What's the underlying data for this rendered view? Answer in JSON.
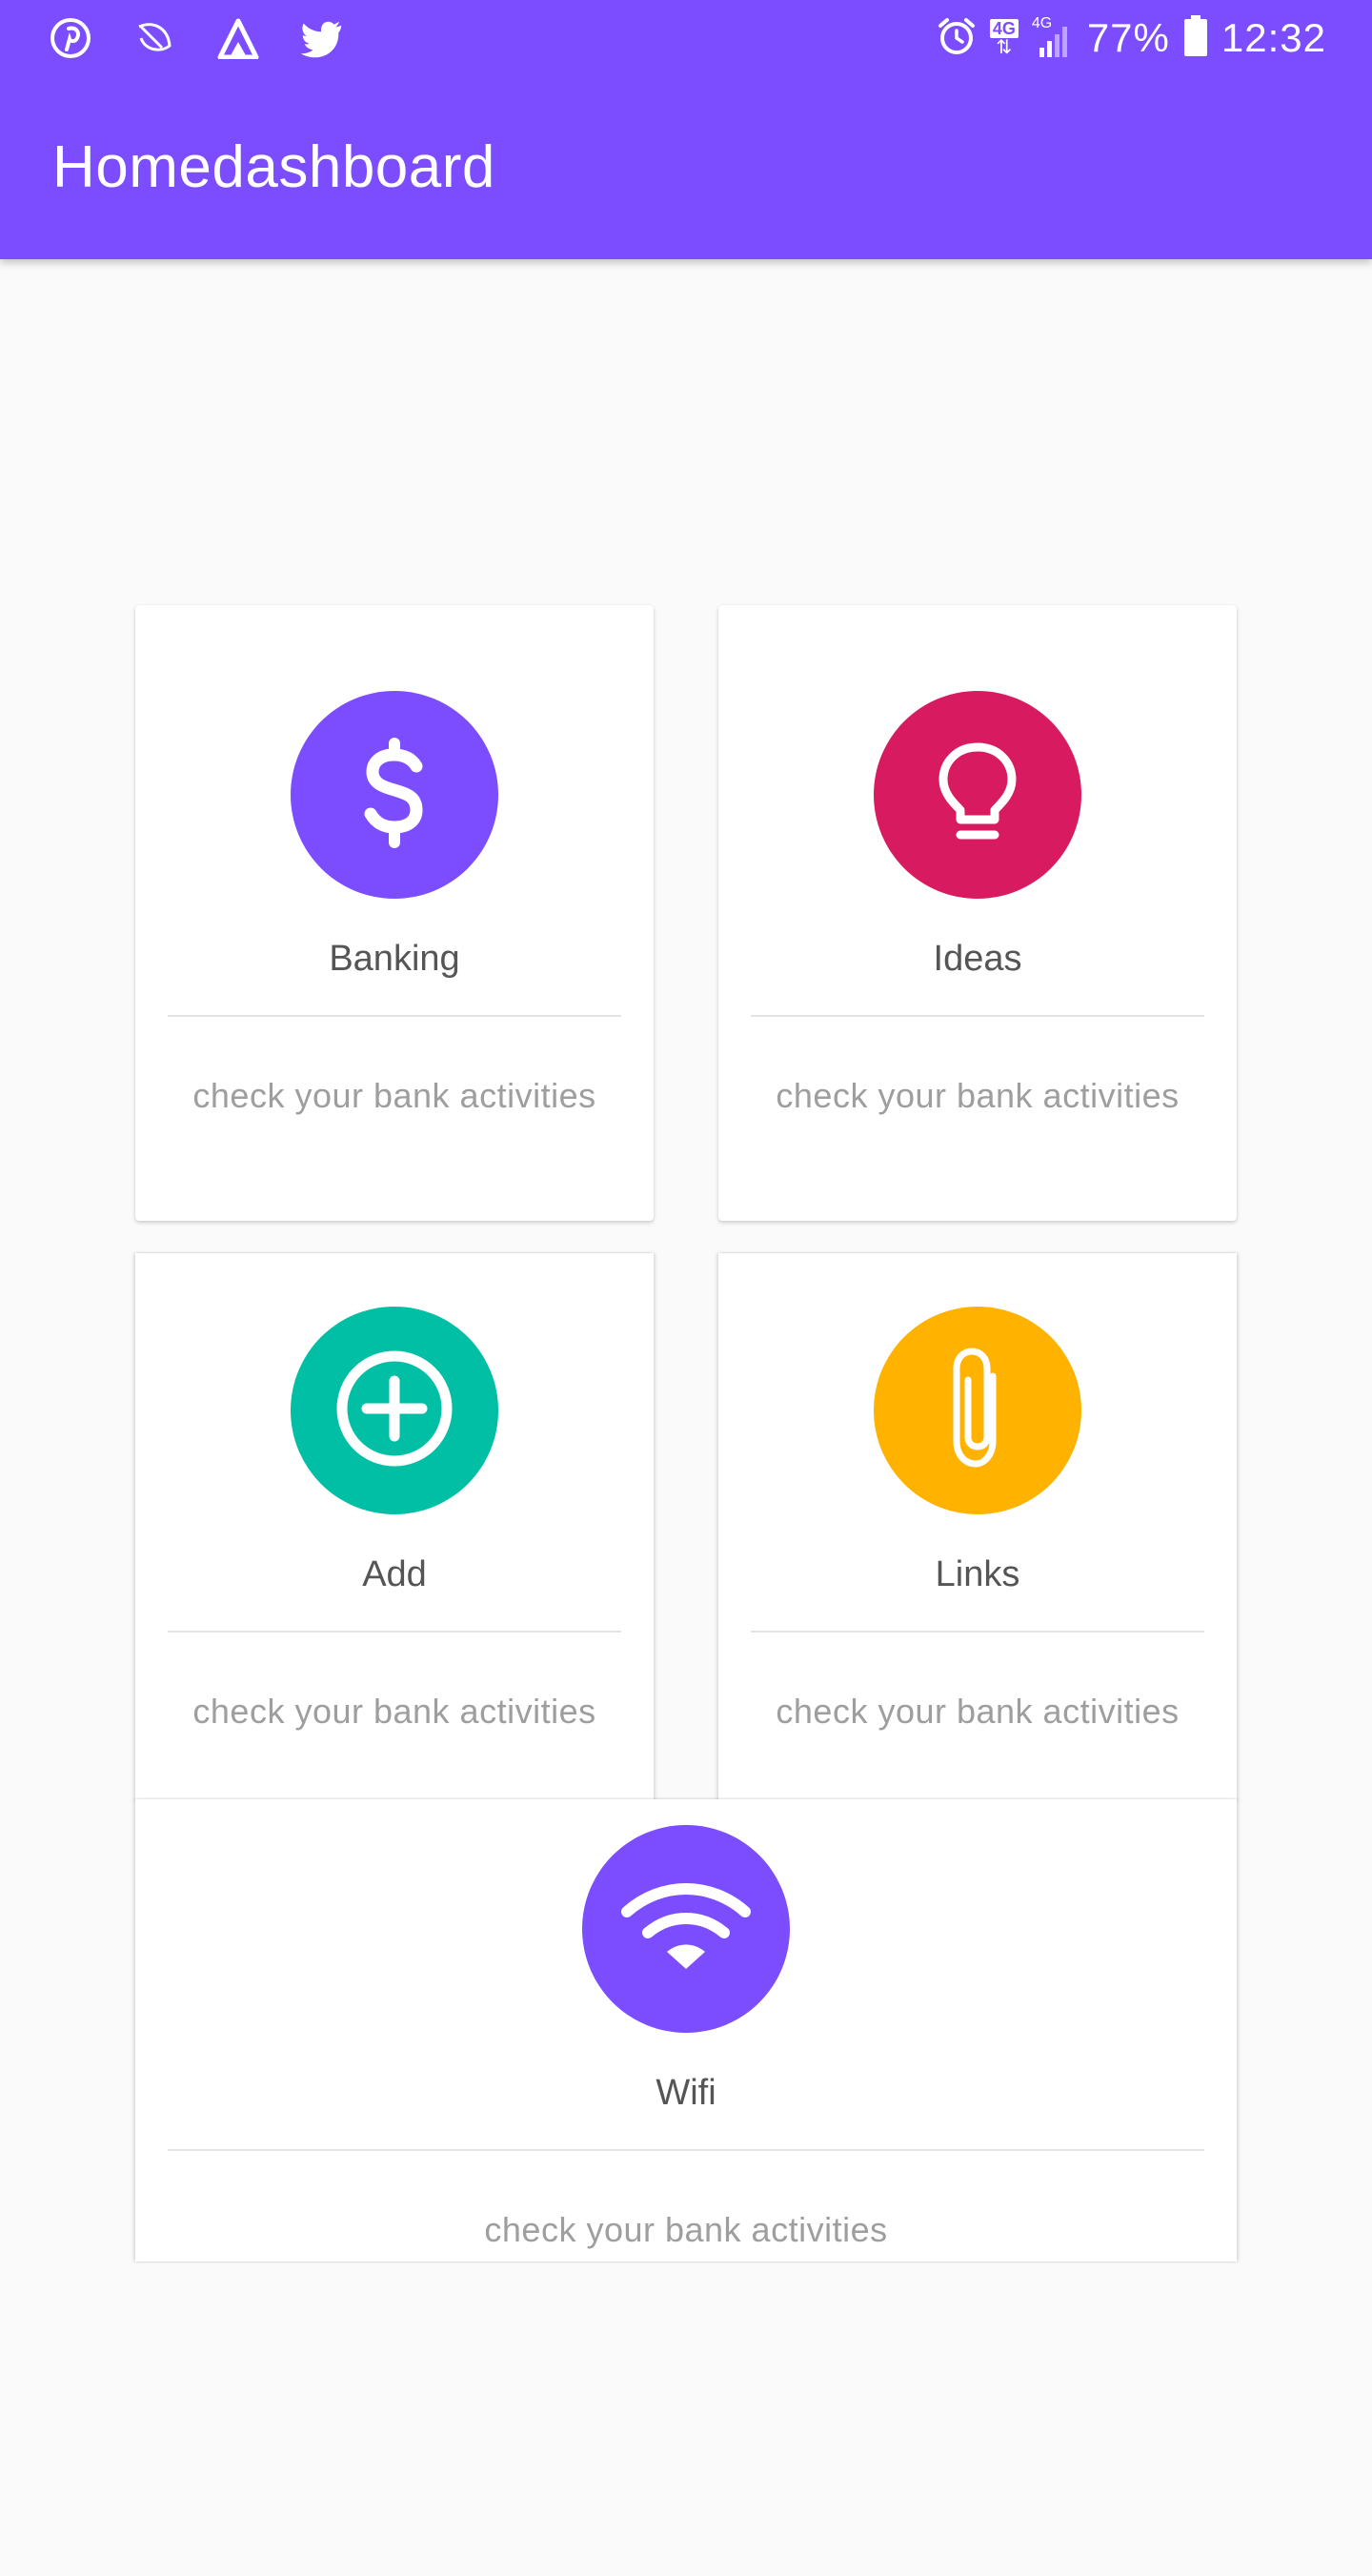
{
  "status_bar": {
    "left_icons": [
      "pinterest-icon",
      "leaf-icon",
      "arrow-a-icon",
      "twitter-icon"
    ],
    "network_4g_top": "4G",
    "network_4g_small": "4G",
    "battery_percent": "77%",
    "time": "12:32"
  },
  "app_bar": {
    "title": "Homedashboard",
    "color": "#7c4dff"
  },
  "cards": [
    {
      "label": "Banking",
      "description": "check your bank activities",
      "icon": "dollar-icon",
      "color": "#7c4dff"
    },
    {
      "label": "Ideas",
      "description": "check your bank activities",
      "icon": "lightbulb-icon",
      "color": "#d81b60"
    },
    {
      "label": "Add",
      "description": "check your bank activities",
      "icon": "add-circle-icon",
      "color": "#00bfa5"
    },
    {
      "label": "Links",
      "description": "check your bank activities",
      "icon": "paperclip-icon",
      "color": "#ffb300"
    },
    {
      "label": "Wifi",
      "description": "check your bank activities",
      "icon": "wifi-icon",
      "color": "#7c4dff"
    }
  ]
}
